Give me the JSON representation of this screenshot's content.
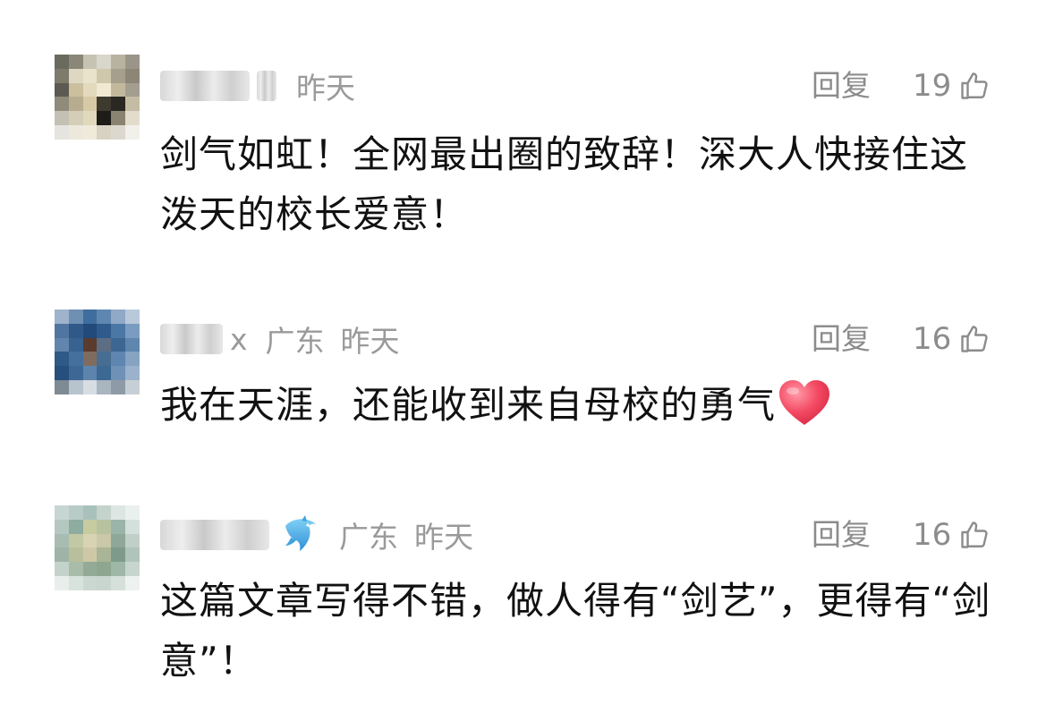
{
  "comments": [
    {
      "user_suffix": "",
      "location": "",
      "time": "昨天",
      "reply_label": "回复",
      "likes": "19",
      "text": "剑气如虹！全网最出圈的致辞！深大人快接住这泼天的校长爱意！",
      "avatar_colors": [
        "#6a6a5e",
        "#8a8778",
        "#c7c3b2",
        "#d9d6cb",
        "#b8b2a0",
        "#9a9588",
        "#7e7a6c",
        "#ded8c2",
        "#e9e3cc",
        "#cfc8ad",
        "#a59f8c",
        "#8d8677",
        "#5d5a51",
        "#cbbf9e",
        "#e3d9bd",
        "#f1e9d2",
        "#c2b99d",
        "#a39e90",
        "#8f8a7a",
        "#b7ac8d",
        "#d7c9a6",
        "#3f3a30",
        "#2b2823",
        "#c5bca4",
        "#c4c0b4",
        "#d4cdb7",
        "#e2d8bc",
        "#1e1c19",
        "#8b8372",
        "#e3dccd",
        "#e6e4de",
        "#ece8dc",
        "#f0eadb",
        "#d8d2c2",
        "#dcd8ce",
        "#f2f0ea"
      ]
    },
    {
      "user_suffix": "x",
      "location": "广东",
      "time": "昨天",
      "reply_label": "回复",
      "likes": "16",
      "text": "我在天涯，还能收到来自母校的勇气",
      "has_heart": true,
      "avatar_colors": [
        "#9fb4cc",
        "#6f8fb3",
        "#3e6d9e",
        "#5e86b0",
        "#8fa9c6",
        "#b9c9da",
        "#5075a0",
        "#30598a",
        "#224a7a",
        "#2e5a8c",
        "#4b77a6",
        "#7a9cc0",
        "#6285ad",
        "#38628f",
        "#5b3b2c",
        "#5c6e84",
        "#3c6792",
        "#5e86ae",
        "#2f5987",
        "#44709d",
        "#7f6c5f",
        "#486d93",
        "#5e86b0",
        "#86a3c2",
        "#274f7e",
        "#3d6895",
        "#5d84ad",
        "#3c6894",
        "#6f91b7",
        "#9ab2cb",
        "#7e8a94",
        "#b7c3cd",
        "#d7dde2",
        "#a9b5bf",
        "#8e9aa6",
        "#c7cfd6"
      ]
    },
    {
      "user_suffix": "",
      "location": "广东",
      "time": "昨天",
      "reply_label": "回复",
      "likes": "16",
      "text": "这篇文章写得不错，做人得有“剑艺”，更得有“剑意”！",
      "has_badge": true,
      "avatar_colors": [
        "#c7d6d3",
        "#b8cbc6",
        "#a9c1bb",
        "#c5d3cd",
        "#dde6e2",
        "#eaf0ed",
        "#b4c8c2",
        "#8eac9f",
        "#c7cba0",
        "#b7c2a1",
        "#9bb4aa",
        "#d4e0db",
        "#a7bdb2",
        "#c3c8a4",
        "#d8d4b3",
        "#c9c8a8",
        "#8fa798",
        "#c0d0c9",
        "#9db4a6",
        "#b9bf9c",
        "#cfc8a6",
        "#a9b596",
        "#7e9a8a",
        "#b0c4bb",
        "#c4d2cc",
        "#a9bca9",
        "#93ab96",
        "#8ea590",
        "#9fb7a6",
        "#c7d5cf",
        "#e8eeec",
        "#d9e3de",
        "#cbd8d1",
        "#c9d6cf",
        "#d6e0db",
        "#edf2f0"
      ]
    }
  ]
}
